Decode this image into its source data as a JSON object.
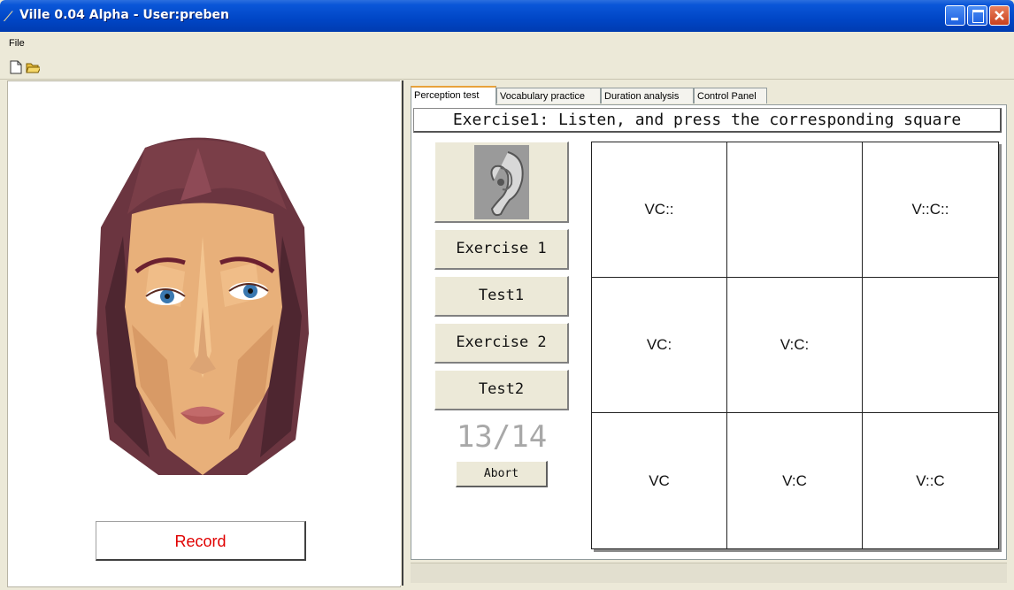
{
  "window": {
    "title": "Ville 0.04 Alpha - User:preben",
    "app_icon": "feather-icon",
    "controls": [
      "minimize-icon",
      "maximize-icon",
      "close-icon"
    ]
  },
  "menu": {
    "items": [
      "File"
    ]
  },
  "toolbar": {
    "icons": [
      "new-document-icon",
      "open-folder-icon"
    ]
  },
  "left_panel": {
    "avatar": "3d-face-avatar",
    "record_label": "Record",
    "record_color": "#e00000"
  },
  "tabs": [
    {
      "label": "Perception test",
      "active": true
    },
    {
      "label": "Vocabulary practice",
      "active": false
    },
    {
      "label": "Duration analysis",
      "active": false
    },
    {
      "label": "Control Panel",
      "active": false
    }
  ],
  "perception": {
    "instruction": "Exercise1: Listen, and press the corresponding square",
    "listen_icon": "ear-icon",
    "buttons": [
      "Exercise 1",
      "Test1",
      "Exercise 2",
      "Test2"
    ],
    "progress": "13/14",
    "abort_label": "Abort",
    "grid": [
      [
        "VC::",
        "",
        "V::C::"
      ],
      [
        "VC:",
        "V:C:",
        ""
      ],
      [
        "VC",
        "V:C",
        "V::C"
      ]
    ]
  }
}
